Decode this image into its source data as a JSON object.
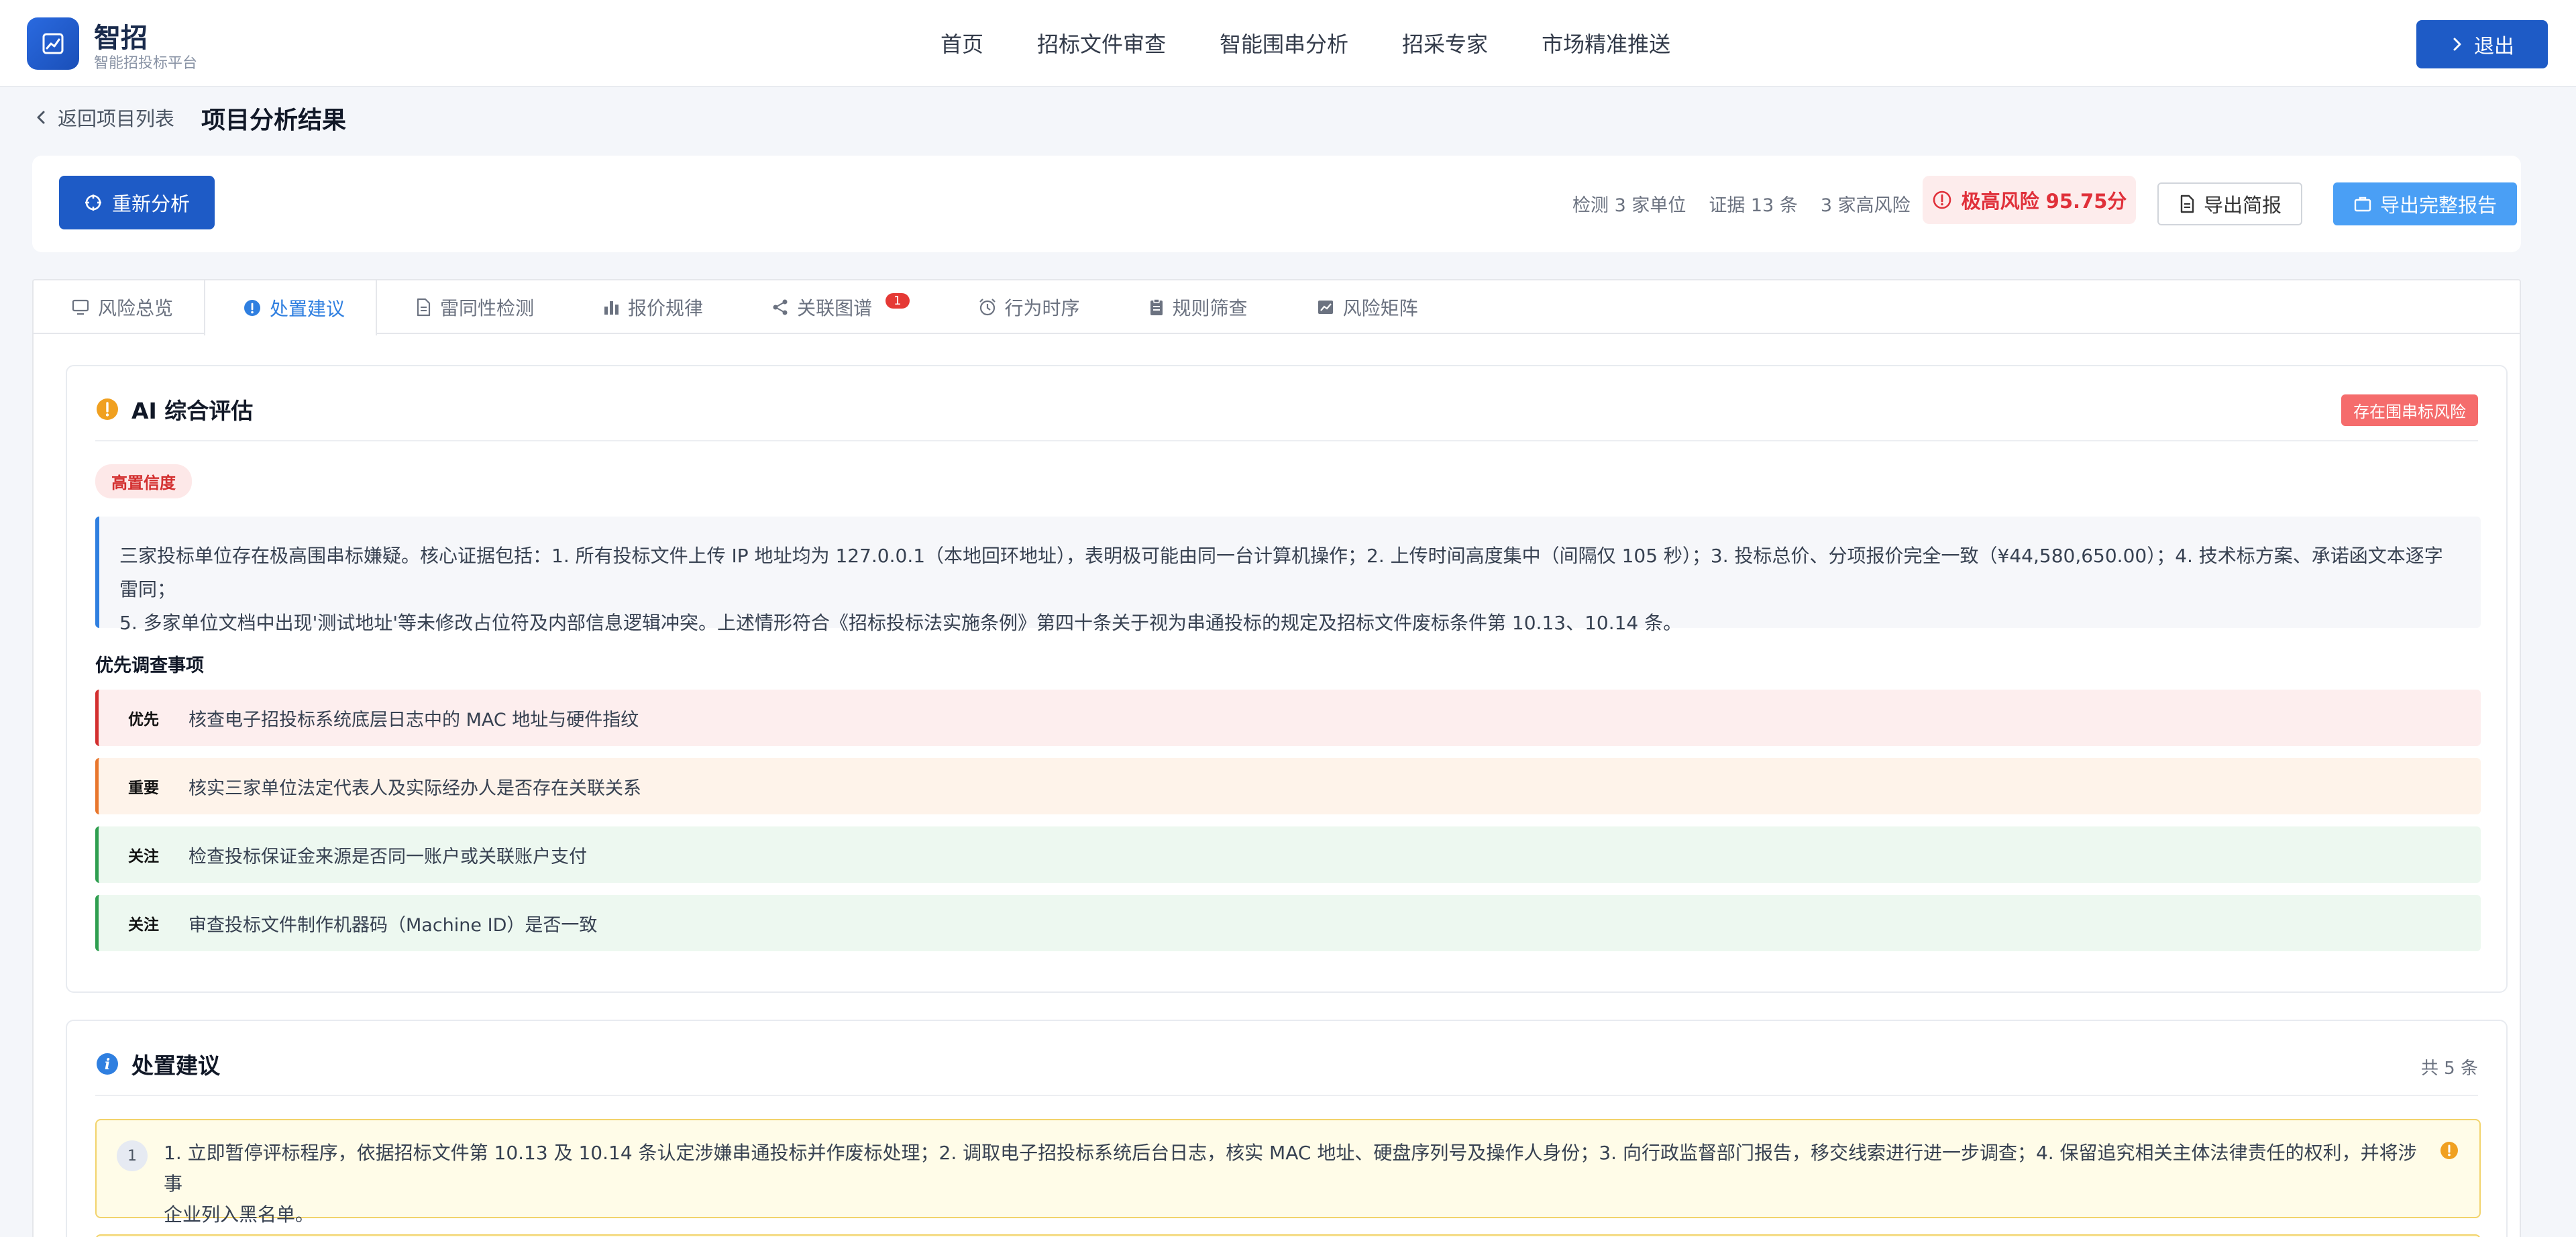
{
  "brand": {
    "name": "智招",
    "subtitle": "智能招投标平台"
  },
  "nav": [
    "首页",
    "招标文件审查",
    "智能围串分析",
    "招采专家",
    "市场精准推送"
  ],
  "header": {
    "logout_label": "退出"
  },
  "breadcrumb": {
    "back_label": "返回项目列表",
    "title": "项目分析结果"
  },
  "actions": {
    "reanalyze_label": "重新分析",
    "stats": [
      "检测 3 家单位",
      "证据 13 条",
      "3 家高风险"
    ],
    "risk_label": "极高风险 95.75分",
    "export_brief_label": "导出简报",
    "export_full_label": "导出完整报告"
  },
  "tabs": [
    {
      "label": "风险总览",
      "icon": "monitor-icon"
    },
    {
      "label": "处置建议",
      "icon": "info-icon",
      "active": true
    },
    {
      "label": "雷同性检测",
      "icon": "document-icon"
    },
    {
      "label": "报价规律",
      "icon": "bar-chart-icon"
    },
    {
      "label": "关联图谱",
      "icon": "share-icon",
      "badge": "1"
    },
    {
      "label": "行为时序",
      "icon": "alarm-clock-icon"
    },
    {
      "label": "规则筛查",
      "icon": "clipboard-icon"
    },
    {
      "label": "风险矩阵",
      "icon": "chart-icon"
    }
  ],
  "ai_card": {
    "title": "AI 综合评估",
    "risk_tag": "存在围串标风险",
    "confidence_tag": "高置信度",
    "summary_line1": "三家投标单位存在极高围串标嫌疑。核心证据包括：1. 所有投标文件上传 IP 地址均为 127.0.0.1（本地回环地址），表明极可能由同一台计算机操作；2. 上传时间高度集中（间隔仅 105 秒）；3. 投标总价、分项报价完全一致（¥44,580,650.00）；4. 技术标方案、承诺函文本逐字雷同；",
    "summary_line2": "5. 多家单位文档中出现'测试地址'等未修改占位符及内部信息逻辑冲突。上述情形符合《招标投标法实施条例》第四十条关于视为串通投标的规定及招标文件废标条件第 10.13、10.14 条。",
    "priority_title": "优先调查事项",
    "priorities": [
      {
        "level": "优先",
        "text": "核查电子招投标系统底层日志中的 MAC 地址与硬件指纹"
      },
      {
        "level": "重要",
        "text": "核实三家单位法定代表人及实际经办人是否存在关联关系"
      },
      {
        "level": "关注",
        "text": "检查投标保证金来源是否同一账户或关联账户支付"
      },
      {
        "level": "关注",
        "text": "审查投标文件制作机器码（Machine ID）是否一致"
      }
    ]
  },
  "advice_card": {
    "title": "处置建议",
    "count": "共 5 条",
    "items": [
      {
        "num": "1",
        "text_line1": "1. 立即暂停评标程序，依据招标文件第 10.13 及 10.14 条认定涉嫌串通投标并作废标处理；2. 调取电子招投标系统后台日志，核实 MAC 地址、硬盘序列号及操作人身份；3. 向行政监督部门报告，移交线索进行进一步调查；4. 保留追究相关主体法律责任的权利，并将涉事",
        "text_line2": "企业列入黑名单。"
      }
    ]
  },
  "colors": {
    "primary": "#1e5bc6",
    "active_tab": "#2f7fe0",
    "danger": "#e0303a",
    "warning": "#f0a020"
  }
}
